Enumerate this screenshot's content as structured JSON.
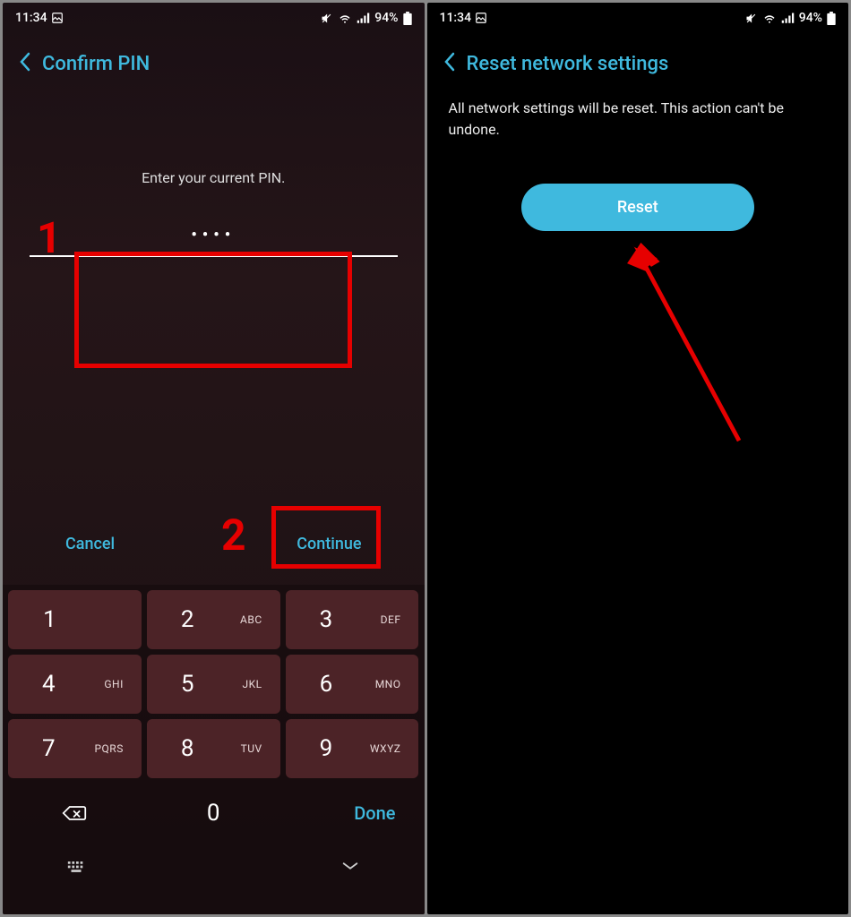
{
  "status": {
    "time": "11:34",
    "battery": "94%"
  },
  "left": {
    "title": "Confirm PIN",
    "prompt": "Enter your current PIN.",
    "pin_display": "••••",
    "cancel": "Cancel",
    "continue": "Continue",
    "keypad": [
      {
        "num": "1",
        "letters": ""
      },
      {
        "num": "2",
        "letters": "ABC"
      },
      {
        "num": "3",
        "letters": "DEF"
      },
      {
        "num": "4",
        "letters": "GHI"
      },
      {
        "num": "5",
        "letters": "JKL"
      },
      {
        "num": "6",
        "letters": "MNO"
      },
      {
        "num": "7",
        "letters": "PQRS"
      },
      {
        "num": "8",
        "letters": "TUV"
      },
      {
        "num": "9",
        "letters": "WXYZ"
      }
    ],
    "done": "Done"
  },
  "right": {
    "title": "Reset network settings",
    "desc": "All network settings will be reset. This action can't be undone.",
    "reset": "Reset"
  },
  "anno": {
    "one": "1",
    "two": "2"
  }
}
